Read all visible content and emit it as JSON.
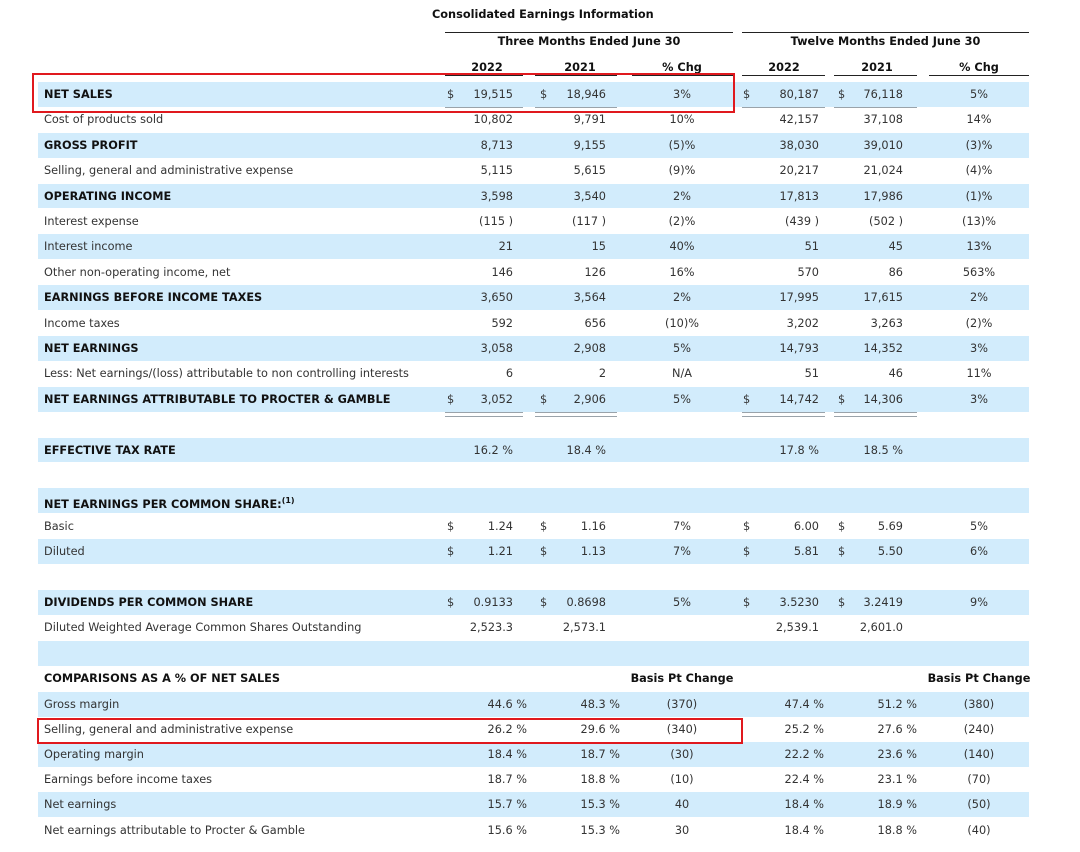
{
  "title": "Consolidated Earnings Information",
  "period_headers": {
    "three_months": "Three Months Ended June 30",
    "twelve_months": "Twelve Months Ended June 30"
  },
  "col_headers": [
    "2022",
    "2021",
    "% Chg",
    "2022",
    "2021",
    "% Chg"
  ],
  "rows": [
    {
      "label": "NET SALES",
      "bold": true,
      "band": true,
      "dollar": true,
      "values": [
        "19,515",
        "18,946",
        "3%",
        "80,187",
        "76,118",
        "5%"
      ]
    },
    {
      "label": "Cost of products sold",
      "bold": false,
      "band": false,
      "dollar": false,
      "values": [
        "10,802",
        "9,791",
        "10%",
        "42,157",
        "37,108",
        "14%"
      ]
    },
    {
      "label": "GROSS PROFIT",
      "bold": true,
      "band": true,
      "dollar": false,
      "values": [
        "8,713",
        "9,155",
        "(5)%",
        "38,030",
        "39,010",
        "(3)%"
      ]
    },
    {
      "label": "Selling, general and administrative expense",
      "bold": false,
      "band": false,
      "dollar": false,
      "values": [
        "5,115",
        "5,615",
        "(9)%",
        "20,217",
        "21,024",
        "(4)%"
      ]
    },
    {
      "label": "OPERATING INCOME",
      "bold": true,
      "band": true,
      "dollar": false,
      "values": [
        "3,598",
        "3,540",
        "2%",
        "17,813",
        "17,986",
        "(1)%"
      ]
    },
    {
      "label": "Interest expense",
      "bold": false,
      "band": false,
      "dollar": false,
      "values": [
        "(115 )",
        "(117 )",
        "(2)%",
        "(439 )",
        "(502 )",
        "(13)%"
      ]
    },
    {
      "label": "Interest income",
      "bold": false,
      "band": true,
      "dollar": false,
      "values": [
        "21",
        "15",
        "40%",
        "51",
        "45",
        "13%"
      ]
    },
    {
      "label": "Other non-operating income, net",
      "bold": false,
      "band": false,
      "dollar": false,
      "values": [
        "146",
        "126",
        "16%",
        "570",
        "86",
        "563%"
      ]
    },
    {
      "label": "EARNINGS BEFORE INCOME TAXES",
      "bold": true,
      "band": true,
      "dollar": false,
      "values": [
        "3,650",
        "3,564",
        "2%",
        "17,995",
        "17,615",
        "2%"
      ]
    },
    {
      "label": "Income taxes",
      "bold": false,
      "band": false,
      "dollar": false,
      "values": [
        "592",
        "656",
        "(10)%",
        "3,202",
        "3,263",
        "(2)%"
      ]
    },
    {
      "label": "NET EARNINGS",
      "bold": true,
      "band": true,
      "dollar": false,
      "values": [
        "3,058",
        "2,908",
        "5%",
        "14,793",
        "14,352",
        "3%"
      ]
    },
    {
      "label": "Less: Net earnings/(loss) attributable to non controlling interests",
      "bold": false,
      "band": false,
      "dollar": false,
      "values": [
        "6",
        "2",
        "N/A",
        "51",
        "46",
        "11%"
      ]
    },
    {
      "label": "NET EARNINGS ATTRIBUTABLE TO PROCTER & GAMBLE",
      "bold": true,
      "band": true,
      "dollar": true,
      "values": [
        "3,052",
        "2,906",
        "5%",
        "14,742",
        "14,306",
        "3%"
      ]
    },
    {
      "label": "",
      "bold": false,
      "band": false,
      "dollar": false,
      "values": [
        "",
        "",
        "",
        "",
        "",
        ""
      ]
    },
    {
      "label": "EFFECTIVE TAX RATE",
      "bold": true,
      "band": true,
      "dollar": false,
      "values": [
        "16.2 %",
        "18.4 %",
        "",
        "17.8 %",
        "18.5 %",
        ""
      ]
    },
    {
      "label": "",
      "bold": false,
      "band": false,
      "dollar": false,
      "values": [
        "",
        "",
        "",
        "",
        "",
        ""
      ]
    },
    {
      "label": "NET EARNINGS PER COMMON SHARE:",
      "sup": "(1)",
      "bold": true,
      "band": true,
      "dollar": false,
      "values": [
        "",
        "",
        "",
        "",
        "",
        ""
      ]
    },
    {
      "label": "Basic",
      "bold": false,
      "band": false,
      "dollar": true,
      "values": [
        "1.24",
        "1.16",
        "7%",
        "6.00",
        "5.69",
        "5%"
      ]
    },
    {
      "label": "Diluted",
      "bold": false,
      "band": true,
      "dollar": true,
      "values": [
        "1.21",
        "1.13",
        "7%",
        "5.81",
        "5.50",
        "6%"
      ]
    },
    {
      "label": "",
      "bold": false,
      "band": false,
      "dollar": false,
      "values": [
        "",
        "",
        "",
        "",
        "",
        ""
      ]
    },
    {
      "label": "DIVIDENDS PER COMMON SHARE",
      "bold": true,
      "band": true,
      "dollar": true,
      "values": [
        "0.9133",
        "0.8698",
        "5%",
        "3.5230",
        "3.2419",
        "9%"
      ]
    },
    {
      "label": "Diluted Weighted Average Common Shares Outstanding",
      "bold": false,
      "band": false,
      "dollar": false,
      "values": [
        "2,523.3",
        "2,573.1",
        "",
        "2,539.1",
        "2,601.0",
        ""
      ]
    },
    {
      "label": "",
      "bold": false,
      "band": true,
      "dollar": false,
      "values": [
        "",
        "",
        "",
        "",
        "",
        ""
      ]
    }
  ],
  "comparisons": {
    "header_label": "COMPARISONS AS A % OF NET SALES",
    "basis_header": "Basis Pt Change",
    "rows": [
      {
        "label": "Gross margin",
        "band": true,
        "values": [
          "44.6 %",
          "48.3 %",
          "(370)",
          "47.4 %",
          "51.2 %",
          "(380)"
        ]
      },
      {
        "label": "Selling, general and administrative expense",
        "band": false,
        "values": [
          "26.2 %",
          "29.6 %",
          "(340)",
          "25.2 %",
          "27.6 %",
          "(240)"
        ]
      },
      {
        "label": "Operating margin",
        "band": true,
        "values": [
          "18.4 %",
          "18.7 %",
          "(30)",
          "22.2 %",
          "23.6 %",
          "(140)"
        ]
      },
      {
        "label": "Earnings before income taxes",
        "band": false,
        "values": [
          "18.7 %",
          "18.8 %",
          "(10)",
          "22.4 %",
          "23.1 %",
          "(70)"
        ]
      },
      {
        "label": "Net earnings",
        "band": true,
        "values": [
          "15.7 %",
          "15.3 %",
          "40",
          "18.4 %",
          "18.9 %",
          "(50)"
        ]
      },
      {
        "label": "Net earnings attributable to Procter & Gamble",
        "band": false,
        "values": [
          "15.6 %",
          "15.3 %",
          "30",
          "18.4 %",
          "18.8 %",
          "(40)"
        ]
      }
    ]
  },
  "dollar_sign": "$",
  "colors": {
    "band": "#d2ecfc",
    "highlight_box": "#e0191e",
    "text": "#333333"
  }
}
